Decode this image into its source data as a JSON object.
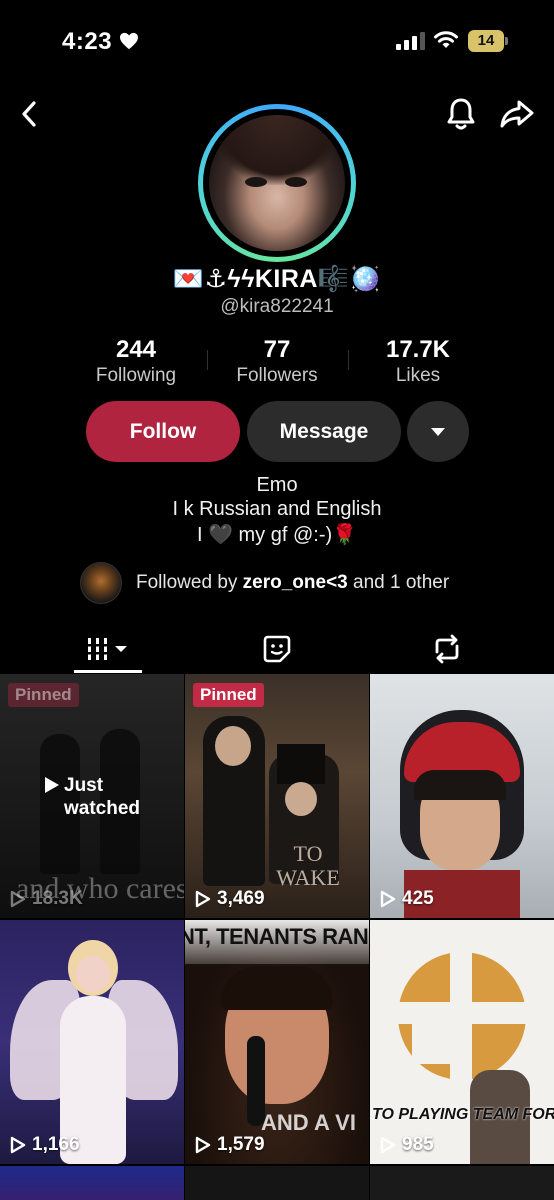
{
  "status_bar": {
    "time": "4:23",
    "battery": "14"
  },
  "profile": {
    "display_name": "💌⚓ϟϟKIRA🎼🪩",
    "handle": "@kira822241",
    "stats": [
      {
        "value": "244",
        "label": "Following"
      },
      {
        "value": "77",
        "label": "Followers"
      },
      {
        "value": "17.7K",
        "label": "Likes"
      }
    ],
    "actions": {
      "follow": "Follow",
      "message": "Message"
    },
    "bio": [
      "Emo",
      "I k Russian and English",
      "I 🖤 my gf @:-)🌹"
    ],
    "followed_by": {
      "prefix": "Followed by ",
      "name": "zero_one<3",
      "suffix": " and 1 other"
    }
  },
  "videos": [
    {
      "badge": "Pinned",
      "views": "18.3K",
      "overlay_text": "and who cares",
      "status": "Just watched"
    },
    {
      "badge": "Pinned",
      "views": "3,469",
      "overlay_text": "TO WAKE"
    },
    {
      "views": "425"
    },
    {
      "views": "1,166"
    },
    {
      "views": "1,579",
      "overlay_text": "NT, TENANTS RANGE",
      "overlay_text_2": "AND A VI"
    },
    {
      "views": "985",
      "overlay_text": "TO PLAYING TEAM FORTRESS"
    }
  ],
  "colors": {
    "follow_button": "#b0243f",
    "secondary_button": "#2c2c2c",
    "background": "#000000"
  }
}
